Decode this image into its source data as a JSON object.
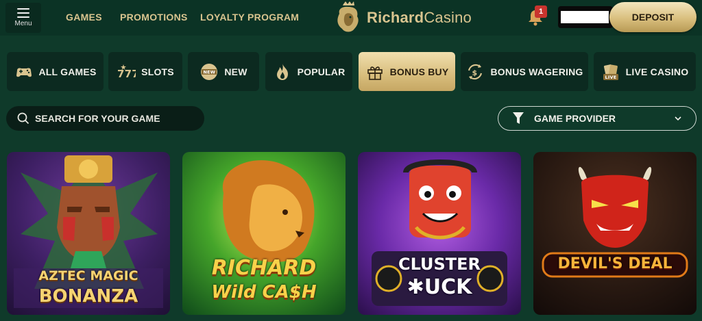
{
  "header": {
    "menu_label": "Menu",
    "nav": [
      "GAMES",
      "PROMOTIONS",
      "LOYALTY PROGRAM"
    ],
    "brand_bold": "Richard",
    "brand_light": "Casino",
    "notification_count": "1",
    "deposit_label": "DEPOSIT"
  },
  "categories": [
    {
      "label": "ALL GAMES",
      "icon": "gamepad-icon"
    },
    {
      "label": "SLOTS",
      "icon": "777-icon"
    },
    {
      "label": "NEW",
      "icon": "new-badge-icon"
    },
    {
      "label": "POPULAR",
      "icon": "flame-icon"
    },
    {
      "label": "BONUS BUY",
      "icon": "gift-icon",
      "active": true
    },
    {
      "label": "BONUS WAGERING",
      "icon": "dollar-cycle-icon"
    },
    {
      "label": "LIVE CASINO",
      "icon": "live-cards-icon"
    }
  ],
  "search": {
    "placeholder": "SEARCH FOR YOUR GAME"
  },
  "provider": {
    "label": "GAME PROVIDER"
  },
  "games": [
    {
      "line1": "AZTEC MAGIC",
      "line2": "BONANZA"
    },
    {
      "line1": "RICHARD",
      "line2": "Wild CA$H"
    },
    {
      "line1": "CLUSTER",
      "line2": "✱UCK"
    },
    {
      "line1": "DEVIL'S DEAL",
      "line2": ""
    }
  ],
  "colors": {
    "accent_gold": "#d9c48f",
    "background": "#0f3a2a",
    "badge_red": "#c9342e"
  }
}
